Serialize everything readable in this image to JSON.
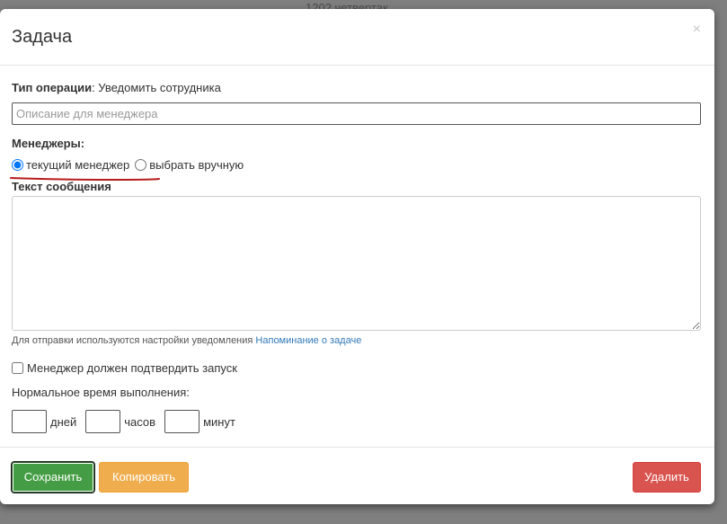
{
  "background": {
    "partial_text": "1202 четвертак"
  },
  "modal": {
    "title": "Задача",
    "close_symbol": "×"
  },
  "operation": {
    "label": "Тип операции",
    "value": ": Уведомить сотрудника"
  },
  "description_input": {
    "placeholder": "Описание для менеджера",
    "value": ""
  },
  "managers": {
    "label": "Менеджеры:",
    "options": [
      {
        "label": "текущий менеджер",
        "selected": true
      },
      {
        "label": "выбрать вручную",
        "selected": false
      }
    ]
  },
  "message": {
    "label": "Текст сообщения",
    "value": ""
  },
  "hint": {
    "text": "Для отправки используются настройки уведомления ",
    "link": "Напоминание о задаче"
  },
  "confirm": {
    "label": "Менеджер должен подтвердить запуск",
    "checked": false
  },
  "normal_time": {
    "label": "Нормальное время выполнения:",
    "fields": [
      {
        "unit": "дней",
        "value": ""
      },
      {
        "unit": "часов",
        "value": ""
      },
      {
        "unit": "минут",
        "value": ""
      }
    ]
  },
  "footer": {
    "save_label": "Сохранить",
    "copy_label": "Копировать",
    "delete_label": "Удалить"
  },
  "colors": {
    "save": "#449d44",
    "copy": "#f0ad4e",
    "delete": "#d9534f",
    "link": "#337ab7",
    "annotation": "#b71c1c"
  }
}
